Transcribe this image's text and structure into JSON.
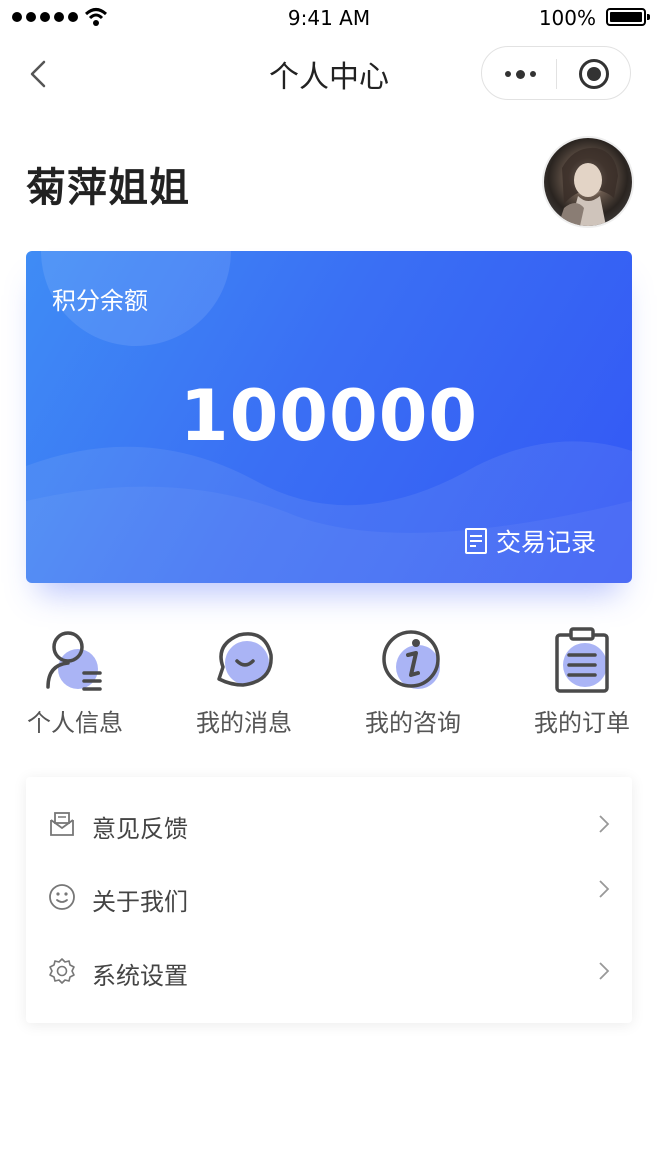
{
  "status_bar": {
    "time": "9:41 AM",
    "battery": "100%"
  },
  "nav": {
    "title": "个人中心"
  },
  "profile": {
    "name": "菊萍姐姐"
  },
  "points_card": {
    "label": "积分余额",
    "amount": "100000",
    "transactions_label": "交易记录"
  },
  "quick_actions": [
    {
      "label": "个人信息",
      "icon": "person-icon"
    },
    {
      "label": "我的消息",
      "icon": "message-icon"
    },
    {
      "label": "我的咨询",
      "icon": "info-icon"
    },
    {
      "label": "我的订单",
      "icon": "clipboard-icon"
    }
  ],
  "menu": [
    {
      "label": "意见反馈",
      "icon": "feedback-icon"
    },
    {
      "label": "关于我们",
      "icon": "smile-icon"
    },
    {
      "label": "系统设置",
      "icon": "gear-icon"
    }
  ],
  "colors": {
    "accent": "#3a6ff4",
    "icon_fill": "#aab4f5",
    "icon_stroke": "#4a4a4a"
  }
}
